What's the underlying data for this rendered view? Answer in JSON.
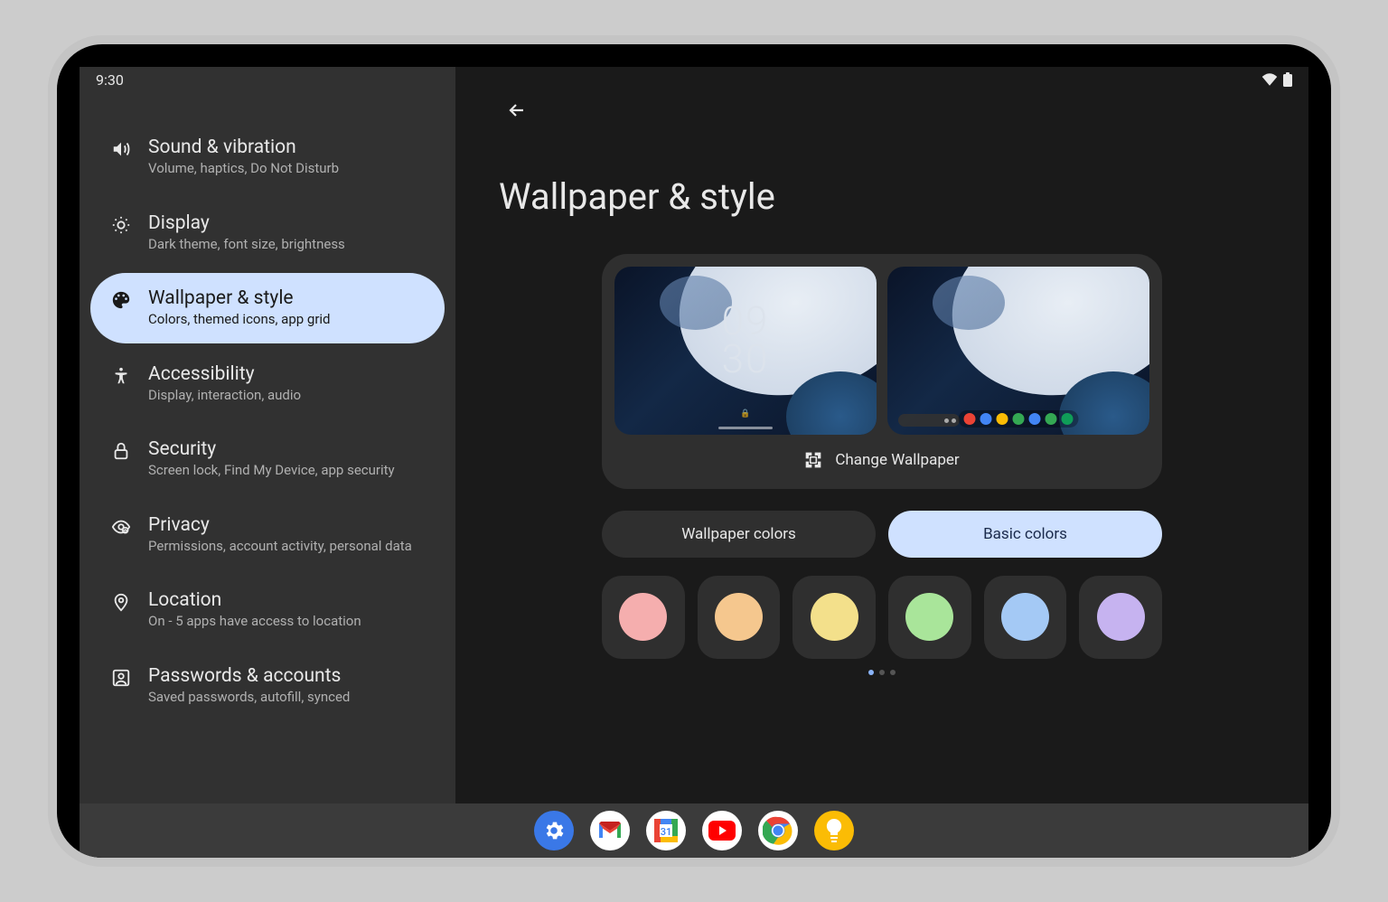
{
  "status": {
    "time": "9:30"
  },
  "sidebar": {
    "items": [
      {
        "title": "Sound & vibration",
        "subtitle": "Volume, haptics, Do Not Disturb"
      },
      {
        "title": "Display",
        "subtitle": "Dark theme, font size, brightness"
      },
      {
        "title": "Wallpaper & style",
        "subtitle": "Colors, themed icons, app grid"
      },
      {
        "title": "Accessibility",
        "subtitle": "Display, interaction, audio"
      },
      {
        "title": "Security",
        "subtitle": "Screen lock, Find My Device, app security"
      },
      {
        "title": "Privacy",
        "subtitle": "Permissions, account activity, personal data"
      },
      {
        "title": "Location",
        "subtitle": "On - 5 apps have access to location"
      },
      {
        "title": "Passwords & accounts",
        "subtitle": "Saved passwords, autofill, synced"
      }
    ],
    "selected_index": 2
  },
  "detail": {
    "title": "Wallpaper & style",
    "lock_clock_top": "09",
    "lock_clock_bottom": "30",
    "change_label": "Change Wallpaper",
    "tabs": {
      "wallpaper": "Wallpaper colors",
      "basic": "Basic colors"
    },
    "active_tab": "basic",
    "colors": [
      "#f5aeae",
      "#f5c78e",
      "#f3e08b",
      "#a9e59a",
      "#a4c9f5",
      "#c6b3f0"
    ]
  },
  "taskbar": {
    "apps": [
      "settings",
      "gmail",
      "calendar",
      "youtube",
      "chrome",
      "keep"
    ]
  }
}
